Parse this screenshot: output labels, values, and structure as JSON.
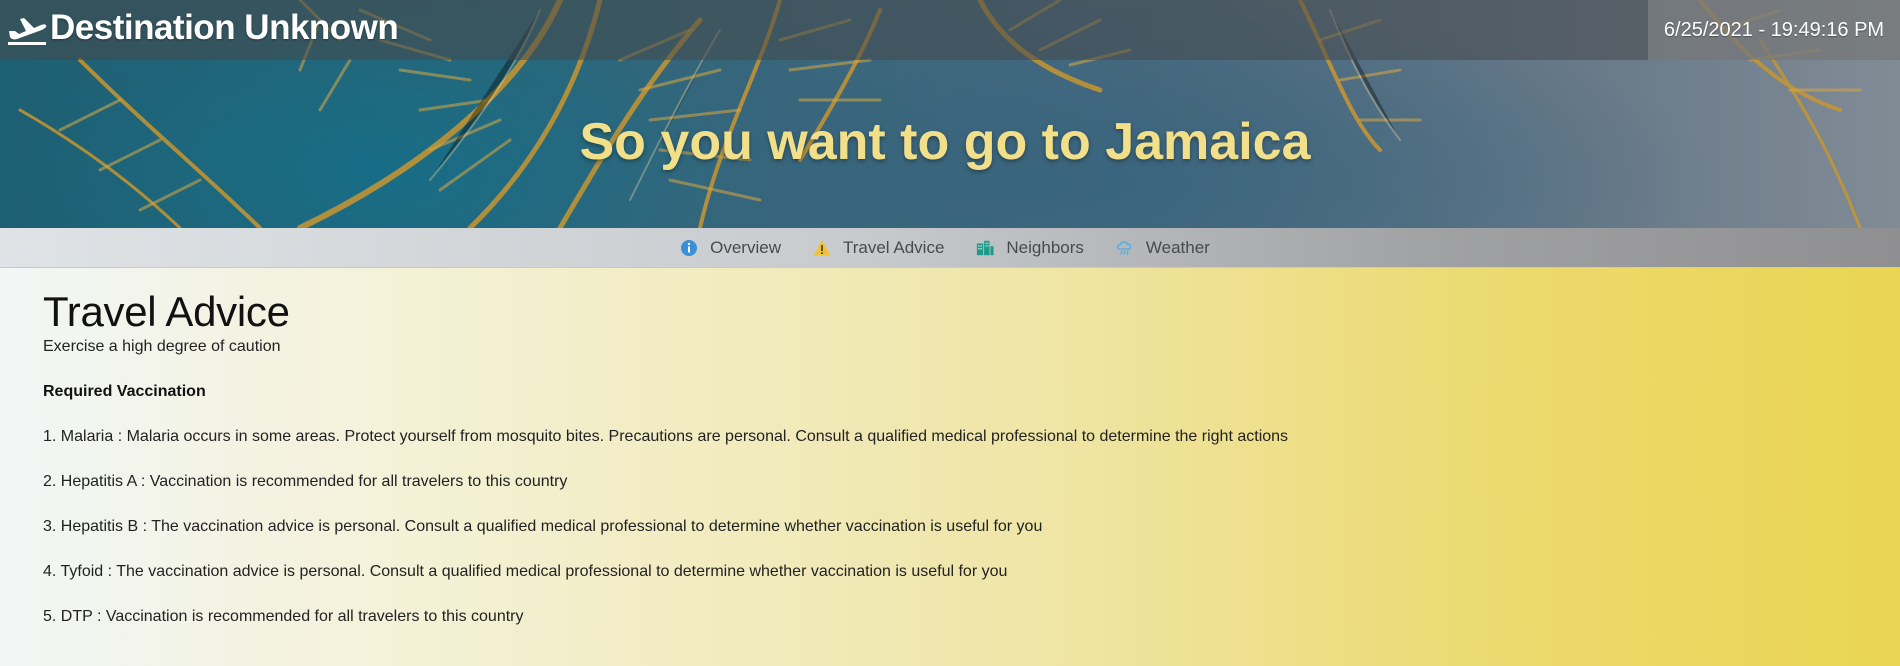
{
  "header": {
    "brand": "Destination Unknown",
    "datetime": "6/25/2021 - 19:49:16 PM",
    "hero_title": "So you want to go to Jamaica"
  },
  "nav": {
    "items": [
      {
        "label": "Overview",
        "icon": "info-circle-icon",
        "color": "#3a8fd8"
      },
      {
        "label": "Travel Advice",
        "icon": "warning-triangle-icon",
        "color": "#f0c23a"
      },
      {
        "label": "Neighbors",
        "icon": "buildings-icon",
        "color": "#1e9a8a"
      },
      {
        "label": "Weather",
        "icon": "cloud-rain-icon",
        "color": "#5aaede"
      }
    ]
  },
  "content": {
    "title": "Travel Advice",
    "advice_level": "Exercise a high degree of caution",
    "vaccination_heading": "Required Vaccination",
    "vaccinations": [
      "1. Malaria : Malaria occurs in some areas. Protect yourself from mosquito bites. Precautions are personal. Consult a qualified medical professional to determine the right actions",
      "2. Hepatitis A : Vaccination is recommended for all travelers to this country",
      "3. Hepatitis B : The vaccination advice is personal. Consult a qualified medical professional to determine whether vaccination is useful for you",
      "4. Tyfoid : The vaccination advice is personal. Consult a qualified medical professional to determine whether vaccination is useful for you",
      "5. DTP : Vaccination is recommended for all travelers to this country"
    ]
  },
  "colors": {
    "hero_title": "#f2df8a",
    "content_gradient_end": "#ead553"
  }
}
